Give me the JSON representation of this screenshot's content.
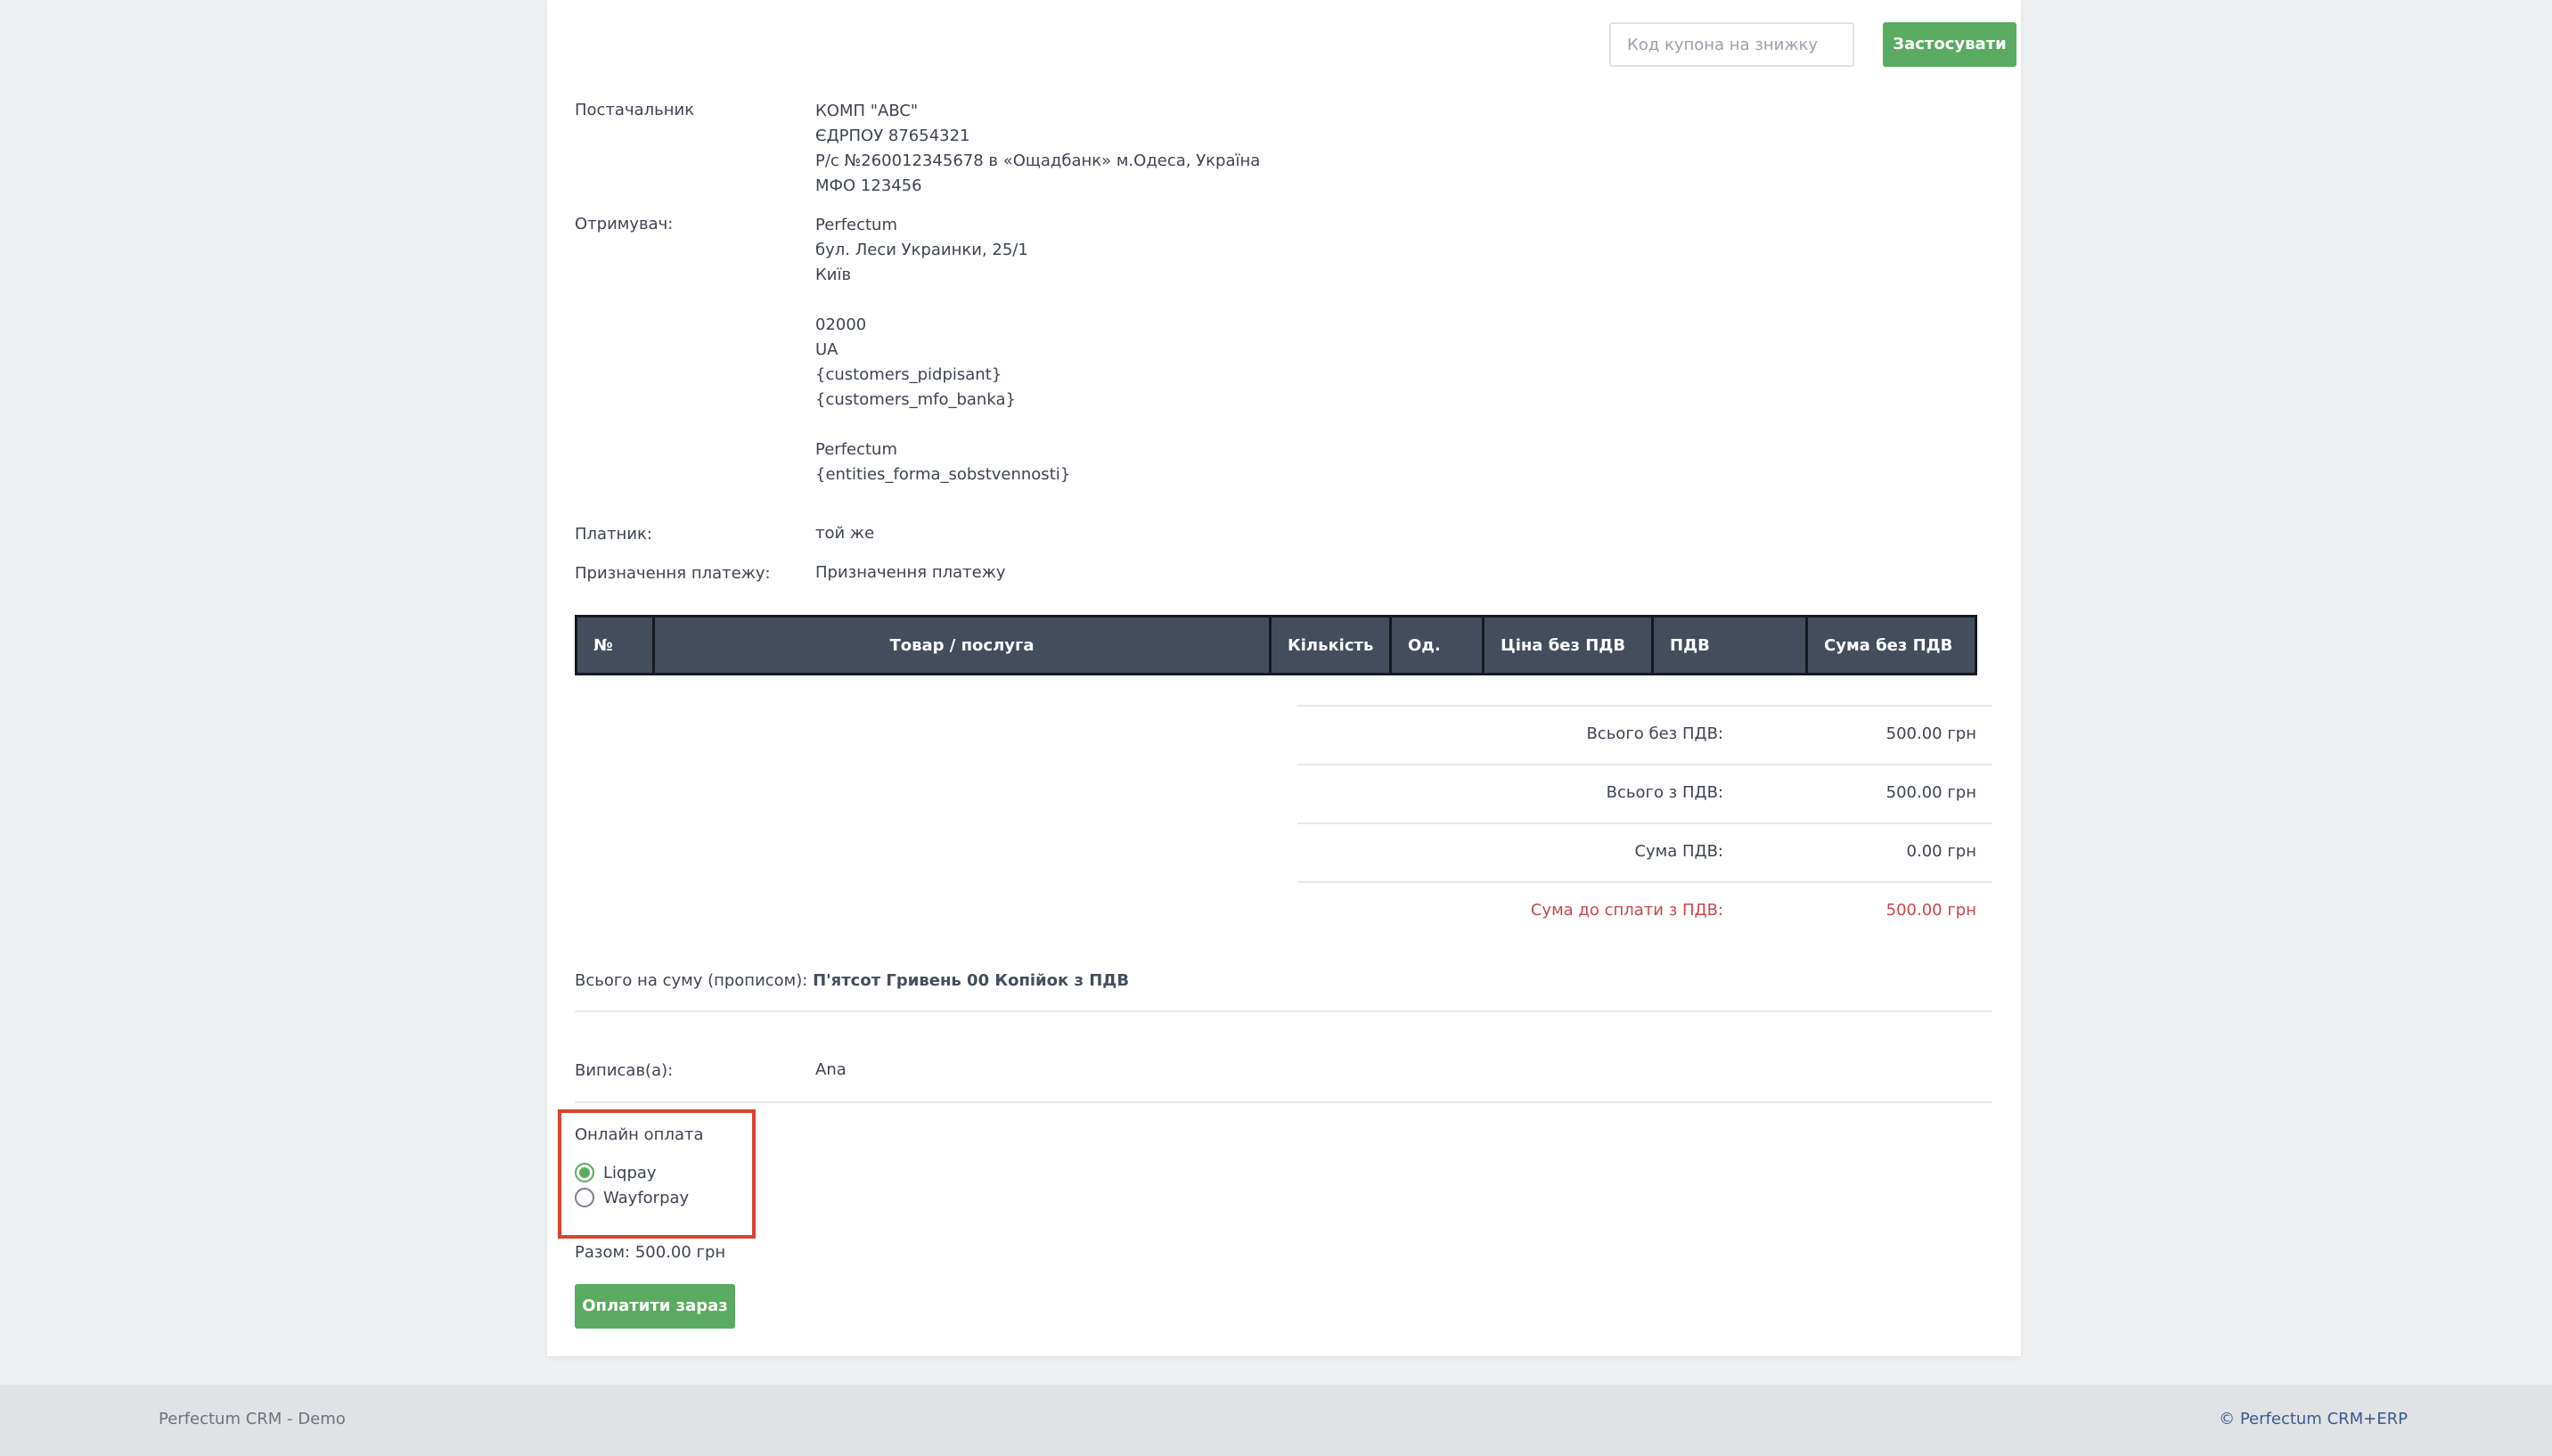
{
  "coupon": {
    "placeholder": "Код купона на знижку",
    "value": "",
    "apply_label": "Застосувати"
  },
  "supplier": {
    "label": "Постачальник",
    "lines": [
      "КОМП \"ABC\"",
      "ЄДРПОУ 87654321",
      "Р/с №260012345678 в «Ощадбанк» м.Одеса, Україна",
      "МФО 123456"
    ]
  },
  "recipient": {
    "label": "Отримувач:",
    "lines": [
      "Perfectum",
      "бул. Леси Украинки, 25/1",
      "Київ",
      "",
      "02000",
      "UA",
      "{customers_pidpisant}",
      "{customers_mfo_banka}",
      "",
      "Perfectum",
      "{entities_forma_sobstvennosti}"
    ]
  },
  "payer": {
    "label": "Платник:",
    "value": "той же"
  },
  "purpose": {
    "label": "Призначення платежу:",
    "value": "Призначення платежу"
  },
  "table": {
    "headers": [
      "№",
      "Товар / послуга",
      "Кількість",
      "Од.",
      "Ціна без ПДВ",
      "ПДВ",
      "Сума без ПДВ"
    ]
  },
  "totals": [
    {
      "label": "Всього без ПДВ:",
      "value": "500.00 грн"
    },
    {
      "label": "Всього з ПДВ:",
      "value": "500.00 грн"
    },
    {
      "label": "Сума ПДВ:",
      "value": "0.00 грн"
    },
    {
      "label": "Сума до сплати з ПДВ:",
      "value": "500.00 грн"
    }
  ],
  "words_total": {
    "label": "Всього на суму (прописом):",
    "value": "П'ятсот Гривень 00 Копійок з ПДВ"
  },
  "issued_by": {
    "label": "Виписав(а):",
    "value": "Ana"
  },
  "online_payment": {
    "title": "Онлайн оплата",
    "options": [
      {
        "label": "Liqpay",
        "selected": true
      },
      {
        "label": "Wayforpay",
        "selected": false
      }
    ]
  },
  "total_line": "Разом: 500.00 грн",
  "pay_now_label": "Оплатити зараз",
  "footer": {
    "left": "Perfectum CRM - Demo",
    "right": "© Perfectum CRM+ERP"
  },
  "colors": {
    "accent_green": "#5aab61",
    "table_header": "#444d5c",
    "total_red": "#c9464c",
    "highlight_box": "#d9442f",
    "footer_link": "#3a5a8c"
  }
}
